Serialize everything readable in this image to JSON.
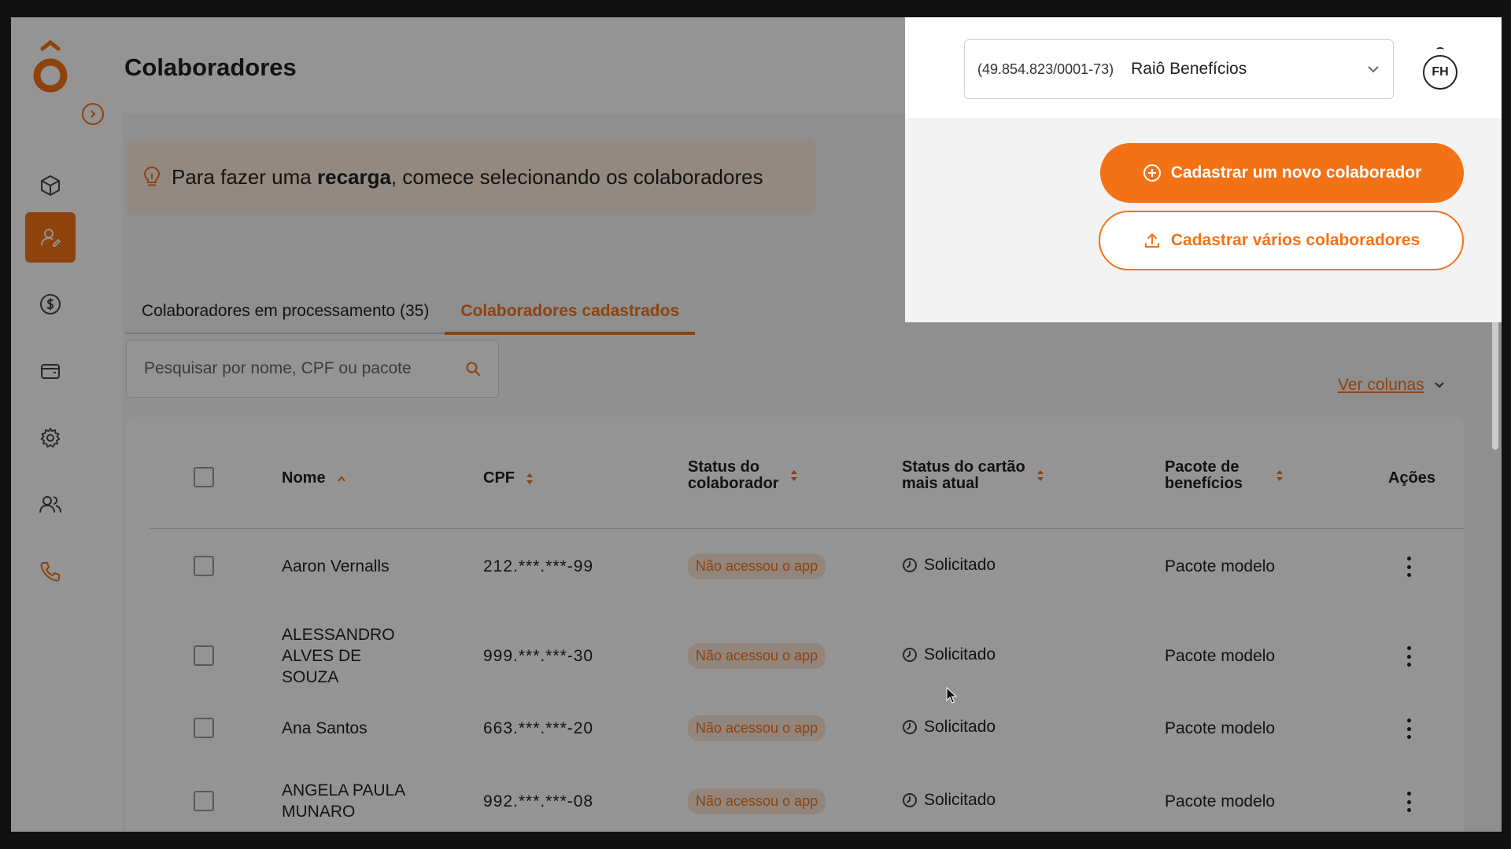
{
  "page": {
    "title": "Colaboradores"
  },
  "tip": {
    "prefix": "Para fazer uma ",
    "bold": "recarga",
    "suffix": ", comece selecionando os colaboradores"
  },
  "tabs": [
    {
      "label": "Colaboradores em processamento (35)",
      "active": false
    },
    {
      "label": "Colaboradores cadastrados",
      "active": true
    }
  ],
  "search": {
    "placeholder": "Pesquisar por nome, CPF ou pacote",
    "value": ""
  },
  "view_columns": {
    "label": "Ver colunas"
  },
  "table": {
    "headers": {
      "name": "Nome",
      "cpf": "CPF",
      "status_line1": "Status do",
      "status_line2": "colaborador",
      "card_line1": "Status do cartão",
      "card_line2": "mais atual",
      "package_line1": "Pacote de",
      "package_line2": "benefícios",
      "actions": "Ações"
    },
    "rows": [
      {
        "name": "Aaron Vernalls",
        "cpf": "212.***.***-99",
        "status": "Não acessou o app",
        "card_status": "Solicitado",
        "package": "Pacote modelo"
      },
      {
        "name": "ALESSANDRO\nALVES DE\nSOUZA",
        "cpf": "999.***.***-30",
        "status": "Não acessou o app",
        "card_status": "Solicitado",
        "package": "Pacote modelo"
      },
      {
        "name": "Ana Santos",
        "cpf": "663.***.***-20",
        "status": "Não acessou o app",
        "card_status": "Solicitado",
        "package": "Pacote modelo"
      },
      {
        "name": "ANGELA PAULA\nMUNARO",
        "cpf": "992.***.***-08",
        "status": "Não acessou o app",
        "card_status": "Solicitado",
        "package": "Pacote modelo"
      }
    ]
  },
  "company": {
    "cnpj": "(49.854.823/0001-73)",
    "name": "Raiô Benefícios"
  },
  "user": {
    "initials": "FH"
  },
  "actions": {
    "primary": "Cadastrar um novo colaborador",
    "secondary": "Cadastrar vários colaboradores"
  },
  "colors": {
    "accent": "#f47216",
    "badge_bg": "#fbe6d6",
    "tip_bg": "#fbece1"
  },
  "icons": {
    "sidebar": [
      "box-icon",
      "user-edit-icon",
      "dollar-icon",
      "wallet-icon",
      "gear-icon",
      "users-icon",
      "phone-icon"
    ]
  }
}
